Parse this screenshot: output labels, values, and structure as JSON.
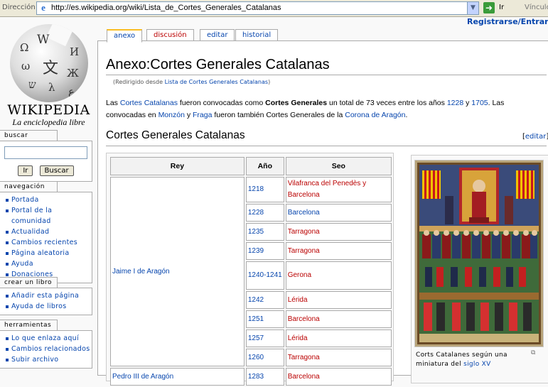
{
  "browser": {
    "address_label": "Dirección",
    "url": "http://es.wikipedia.org/wiki/Lista_de_Cortes_Generales_Catalanas",
    "go_label": "Ir",
    "links_label": "Vínculo"
  },
  "logo": {
    "wordmark": "WIKIPEDIA",
    "tagline": "La enciclopedia libre"
  },
  "personal": {
    "login": "Registrarse/Entrar"
  },
  "tabs": [
    {
      "label": "anexo",
      "selected": true
    },
    {
      "label": "discusión",
      "selected": false
    },
    {
      "label": "editar",
      "selected": false
    },
    {
      "label": "historial",
      "selected": false
    }
  ],
  "sidebar": {
    "search": {
      "title": "buscar",
      "go": "Ir",
      "search": "Buscar"
    },
    "navigation": {
      "title": "navegación",
      "items": [
        "Portada",
        "Portal de la comunidad",
        "Actualidad",
        "Cambios recientes",
        "Página aleatoria",
        "Ayuda",
        "Donaciones"
      ]
    },
    "book": {
      "title": "crear un libro",
      "items": [
        "Añadir esta página",
        "Ayuda de libros"
      ]
    },
    "tools": {
      "title": "herramientas",
      "items": [
        "Lo que enlaza aquí",
        "Cambios relacionados",
        "Subir archivo"
      ]
    }
  },
  "article": {
    "title": "Anexo:Cortes Generales Catalanas",
    "redirect_prefix": "(Redirigido desde ",
    "redirect_link": "Lista de Cortes Generales Catalanas",
    "redirect_suffix": ")",
    "intro": {
      "p1": "Las ",
      "l1": "Cortes Catalanas",
      "p2": " fueron convocadas como ",
      "b1": "Cortes Generales",
      "p3": " un total de 73 veces entre los años ",
      "l2": "1228",
      "p4": " y ",
      "l3": "1705",
      "p5": ". Las convocadas en ",
      "l4": "Monzón",
      "p6": " y ",
      "l5": "Fraga",
      "p7": " fueron también Cortes Generales de la ",
      "l6": "Corona de Aragón",
      "p8": "."
    },
    "section_title": "Cortes Generales Catalanas",
    "edit_open": "[",
    "edit_label": "editar",
    "edit_close": "]",
    "table": {
      "headers": [
        "Rey",
        "Año",
        "Seo"
      ],
      "king1": "Jaime I de Aragón",
      "king2": "Pedro III de Aragón",
      "rows": [
        {
          "year": "1218",
          "seo": "Vilafranca del Penedès y Barcelona"
        },
        {
          "year": "1228",
          "seo": "Barcelona"
        },
        {
          "year": "1235",
          "seo": "Tarragona"
        },
        {
          "year": "1239",
          "seo": "Tarragona"
        },
        {
          "year": "1240-1241",
          "seo": "Gerona"
        },
        {
          "year": "1242",
          "seo": "Lérida"
        },
        {
          "year": "1251",
          "seo": "Barcelona"
        },
        {
          "year": "1257",
          "seo": "Lérida"
        },
        {
          "year": "1260",
          "seo": "Tarragona"
        },
        {
          "year": "1283",
          "seo": "Barcelona"
        }
      ]
    },
    "thumb": {
      "caption_text": "Corts Catalanes según una miniatura del ",
      "caption_link": "siglo XV"
    }
  },
  "colors": {
    "link": "#0645ad",
    "new_link": "#ba0000",
    "tab_accent": "#fabd23"
  }
}
